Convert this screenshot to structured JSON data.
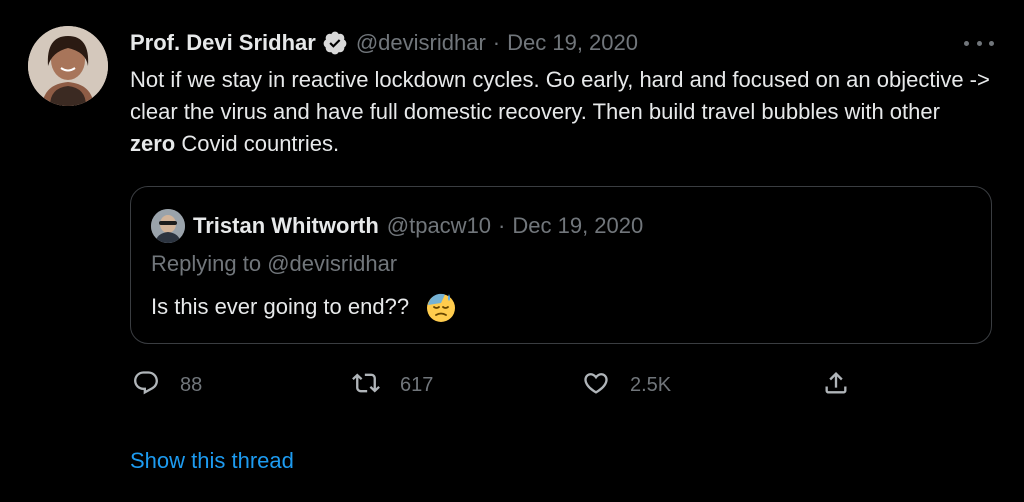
{
  "colors": {
    "background": "#000000",
    "primary_text": "#e7e9ea",
    "secondary_text": "#71767b",
    "link": "#1d9bf0",
    "verified_badge": "#d9d9d9",
    "border": "#3a3d41"
  },
  "tweet": {
    "author_name": "Prof. Devi Sridhar",
    "verified_icon": "verified-badge-icon",
    "handle": "@devisridhar",
    "separator": "·",
    "date": "Dec 19, 2020",
    "more_icon": "more-horizontal-icon",
    "text_before": "Not if we stay in reactive lockdown cycles. Go early, hard and focused on an objective -> clear the virus and have full domestic recovery. Then build travel bubbles with other ",
    "text_bold": "zero",
    "text_after": " Covid countries."
  },
  "quoted_tweet": {
    "author_name": "Tristan Whitworth",
    "handle": "@tpacw10",
    "separator": "·",
    "date": "Dec 19, 2020",
    "replying_prefix": "Replying to ",
    "replying_to": "@devisridhar",
    "text": "Is this ever going to end??",
    "emoji": "downcast-face-with-sweat-icon"
  },
  "actions": {
    "reply": {
      "icon": "reply-icon",
      "count": "88"
    },
    "retweet": {
      "icon": "retweet-icon",
      "count": "617"
    },
    "like": {
      "icon": "like-heart-icon",
      "count": "2.5K"
    },
    "share": {
      "icon": "share-icon"
    }
  },
  "show_thread": "Show this thread"
}
